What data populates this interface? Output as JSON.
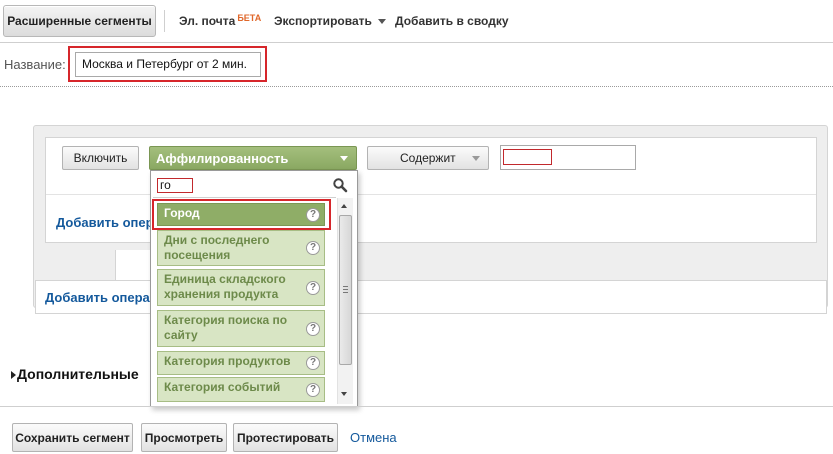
{
  "toolbar": {
    "segments_label": "Расширенные сегменты",
    "email_label": "Эл. почта",
    "email_badge": "БЕТА",
    "export_label": "Экспортировать",
    "add_dashboard_label": "Добавить в сводку"
  },
  "name_field": {
    "label": "Название:",
    "value": "Москва и Петербург от 2 мин."
  },
  "condition": {
    "include_label": "Включить",
    "dimension_value": "Аффилированность",
    "match_type_value": "Содержит",
    "value_input": "",
    "add_or_label": "Добавить опер",
    "add_and_label": "Добавить опера"
  },
  "dimension_dropdown": {
    "search_value": "го",
    "items": [
      {
        "label": "Город",
        "selected": true
      },
      {
        "label": "Дни с последнего посещения",
        "selected": false
      },
      {
        "label": "Единица складского хранения продукта",
        "selected": false
      },
      {
        "label": "Категория поиска по сайту",
        "selected": false
      },
      {
        "label": "Категория продуктов",
        "selected": false
      },
      {
        "label": "Категория событий",
        "selected": false
      }
    ],
    "help_glyph": "?"
  },
  "advanced": {
    "label": "Дополнительные"
  },
  "footer": {
    "save_label": "Сохранить сегмент",
    "preview_label": "Просмотреть",
    "test_label": "Протестировать",
    "cancel_label": "Отмена"
  },
  "icons": {
    "search": "magnifier-icon",
    "help": "question-circle-icon",
    "dropdown": "chevron-down-icon",
    "expand": "triangle-right-icon"
  },
  "colors": {
    "accent_green": "#8fad67",
    "item_green_light": "#d8e5c4",
    "highlight_red": "#d6262b",
    "link_blue": "#14599c",
    "beta_orange": "#e0672a"
  }
}
